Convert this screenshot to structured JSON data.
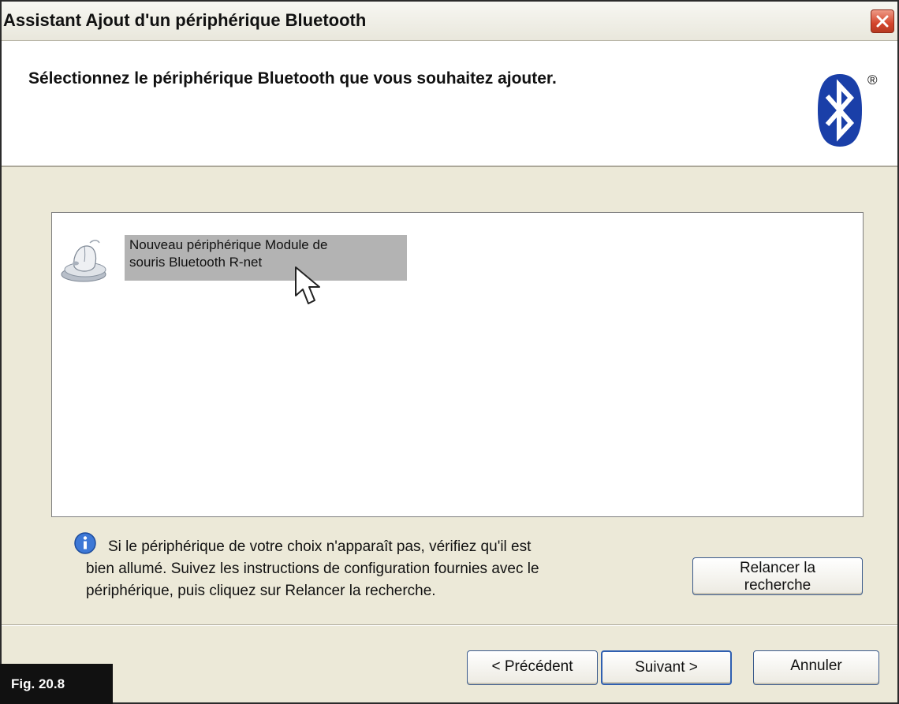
{
  "window": {
    "title": "Assistant Ajout d'un périphérique Bluetooth",
    "close_icon": "close-icon"
  },
  "header": {
    "title": "Sélectionnez le périphérique Bluetooth que vous souhaitez ajouter.",
    "logo_icon": "bluetooth-logo",
    "registered_mark": "®"
  },
  "device_list": {
    "items": [
      {
        "icon": "mouse-device-icon",
        "label_line1": "Nouveau périphérique Module de",
        "label_line2": "souris Bluetooth R-net",
        "selected": true
      }
    ]
  },
  "info": {
    "icon": "info-icon",
    "line1": "Si le périphérique de votre choix n'apparaît pas, vérifiez qu'il est",
    "line2": "bien allumé. Suivez les instructions de configuration fournies avec le",
    "line3": "périphérique, puis cliquez sur Relancer la recherche."
  },
  "rescan_button": {
    "line1": "Relancer la",
    "line2": "recherche"
  },
  "footer": {
    "prev_label": "< Précédent",
    "next_label": "Suivant >",
    "cancel_label": "Annuler"
  },
  "figure_label": "Fig. 20.8",
  "colors": {
    "dialog_bg": "#ece9d8",
    "selection": "#b3b3b3",
    "bluetooth_blue": "#1a3fa8",
    "close_red": "#d4452c"
  }
}
